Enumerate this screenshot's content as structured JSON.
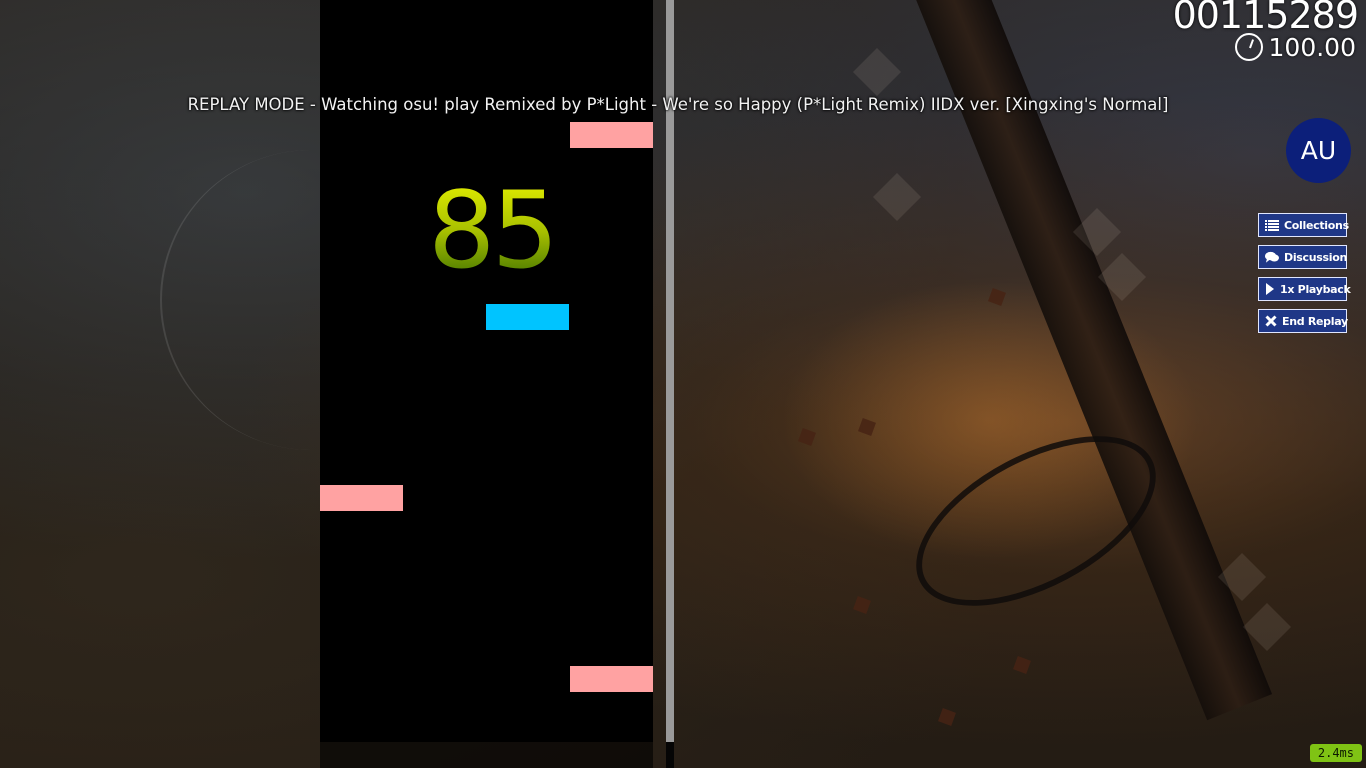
{
  "hud": {
    "score": "00115289",
    "accuracy": "100.00",
    "combo": "85",
    "replay_banner": "REPLAY MODE - Watching osu! play Remixed by P*Light - We're so Happy (P*Light Remix) IIDX ver. [Xingxing's Normal]",
    "latency": "2.4ms"
  },
  "user": {
    "avatar_initials": "AU"
  },
  "menu": {
    "collections": "Collections",
    "discussion": "Discussion",
    "playback": "1x Playback",
    "end_replay": "End Replay"
  },
  "icons": {
    "collections": "list-icon",
    "discussion": "chat-bubble-icon",
    "playback": "play-icon",
    "end_replay": "close-icon",
    "accuracy": "pie-chart-icon"
  },
  "colors": {
    "note_pink": "#ffa2a2",
    "note_blue": "#00c4ff",
    "button_bg": "#1f3787",
    "avatar_bg": "#0c1f7a",
    "latency_bg": "#7fc314",
    "combo_top": "#e4ef00",
    "combo_bottom": "#3d6f00"
  }
}
